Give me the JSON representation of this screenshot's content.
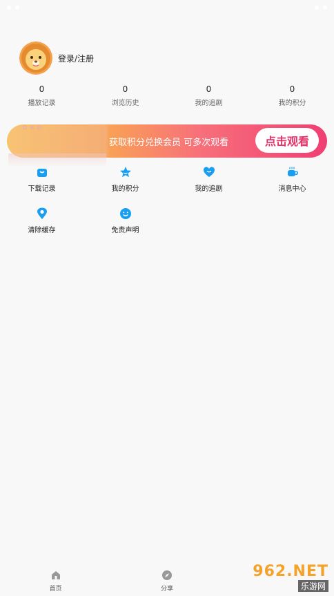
{
  "colors": {
    "accent_blue": "#1a9ff0",
    "banner_pink": "#e5336a"
  },
  "profile": {
    "login_label": "登录/注册",
    "avatar_icon": "lion-avatar-icon"
  },
  "stats": [
    {
      "value": "0",
      "label": "播放记录"
    },
    {
      "value": "0",
      "label": "浏览历史"
    },
    {
      "value": "0",
      "label": "我的追剧"
    },
    {
      "value": "0",
      "label": "我的积分"
    }
  ],
  "banner": {
    "promo_text": "获取积分兑换会员  可多次观看",
    "cta_label": "点击观看"
  },
  "menu": [
    {
      "label": "下载记录",
      "icon": "shopping-bag-icon"
    },
    {
      "label": "我的积分",
      "icon": "star-icon"
    },
    {
      "label": "我的追剧",
      "icon": "heart-icon"
    },
    {
      "label": "消息中心",
      "icon": "coffee-cup-icon"
    },
    {
      "label": "清除缓存",
      "icon": "location-pin-icon"
    },
    {
      "label": "免责声明",
      "icon": "smile-icon"
    }
  ],
  "tabbar": [
    {
      "label": "首页",
      "icon": "home-icon"
    },
    {
      "label": "分享",
      "icon": "compass-icon"
    }
  ],
  "watermark": {
    "number": "962.NET",
    "subtitle": "乐游网"
  }
}
